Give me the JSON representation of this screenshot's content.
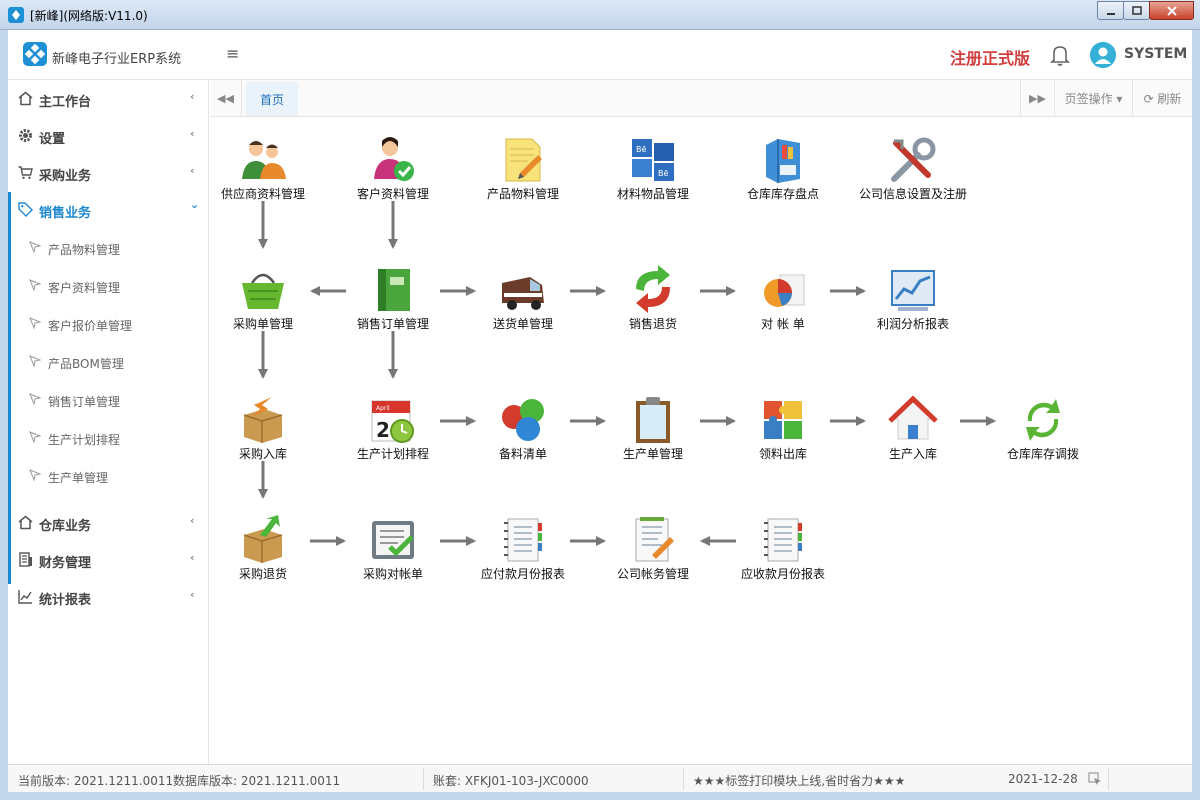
{
  "window": {
    "title": "[新峰](网络版:V11.0)"
  },
  "header": {
    "app_name": "新峰电子行业ERP系统",
    "menu_toggle": "≡",
    "register_label": "注册正式版",
    "user_name": "SYSTEM"
  },
  "sidebar": {
    "items": [
      {
        "label": "主工作台",
        "chev": "‹"
      },
      {
        "label": "设置",
        "chev": "‹"
      },
      {
        "label": "采购业务",
        "chev": "‹"
      },
      {
        "label": "销售业务",
        "chev": "⌄"
      },
      {
        "label": "仓库业务",
        "chev": "‹"
      },
      {
        "label": "财务管理",
        "chev": "‹"
      },
      {
        "label": "统计报表",
        "chev": "‹"
      }
    ],
    "sub_items": [
      {
        "label": "产品物料管理"
      },
      {
        "label": "客户资料管理"
      },
      {
        "label": "客户报价单管理"
      },
      {
        "label": "产品BOM管理"
      },
      {
        "label": "销售订单管理"
      },
      {
        "label": "生产计划排程"
      },
      {
        "label": "生产单管理"
      }
    ]
  },
  "tabs": {
    "nav_left": "◀◀",
    "home": "首页",
    "nav_right": "▶▶",
    "ops": "页签操作 ▾",
    "refresh": "⟳ 刷新"
  },
  "modules": [
    {
      "label": "供应商资料管理",
      "icon": "supplier-icon",
      "color": "#e8892c"
    },
    {
      "label": "客户资料管理",
      "icon": "customer-icon",
      "color": "#3ab54a"
    },
    {
      "label": "产品物料管理",
      "icon": "note-icon",
      "color": "#f3d34a"
    },
    {
      "label": "材料物品管理",
      "icon": "boxes-icon",
      "color": "#2f6fc2"
    },
    {
      "label": "仓库库存盘点",
      "icon": "archive-icon",
      "color": "#3f8fd6"
    },
    {
      "label": "公司信息设置及注册",
      "icon": "tools-icon",
      "color": "#7a8a99"
    },
    {
      "label": "采购单管理",
      "icon": "basket-icon",
      "color": "#66b82e"
    },
    {
      "label": "销售订单管理",
      "icon": "book-icon",
      "color": "#4aa63c"
    },
    {
      "label": "送货单管理",
      "icon": "van-icon",
      "color": "#6b3c2a"
    },
    {
      "label": "销售退货",
      "icon": "return-icon",
      "color": "#d33b2c"
    },
    {
      "label": "对 帐 单",
      "icon": "piechart-icon",
      "color": "#f09a2a"
    },
    {
      "label": "利润分析报表",
      "icon": "linechart-icon",
      "color": "#3a7fc4"
    },
    {
      "label": "采购入库",
      "icon": "box-in-icon",
      "color": "#c99a4f"
    },
    {
      "label": "生产计划排程",
      "icon": "calendar-icon",
      "color": "#d8352b"
    },
    {
      "label": "备料清单",
      "icon": "spheres-icon",
      "color": "#2e86d4"
    },
    {
      "label": "生产单管理",
      "icon": "clipboard-icon",
      "color": "#6a8fb2"
    },
    {
      "label": "领料出库",
      "icon": "puzzle-icon",
      "color": "#e0542f"
    },
    {
      "label": "生产入库",
      "icon": "house-icon",
      "color": "#3a7fd0"
    },
    {
      "label": "仓库库存调拨",
      "icon": "recycle-icon",
      "color": "#5ab535"
    },
    {
      "label": "采购退货",
      "icon": "box-out-icon",
      "color": "#c99a4f"
    },
    {
      "label": "采购对帐单",
      "icon": "checklist-icon",
      "color": "#6f7a82"
    },
    {
      "label": "应付款月份报表",
      "icon": "notebook-icon",
      "color": "#8a9aa8"
    },
    {
      "label": "公司帐务管理",
      "icon": "document-icon",
      "color": "#6f8aa0"
    },
    {
      "label": "应收款月份报表",
      "icon": "notebook-icon",
      "color": "#8a9aa8"
    }
  ],
  "status": {
    "version": "当前版本: 2021.1211.0011",
    "db_version": "数据库版本: 2021.1211.0011",
    "account": "账套: XFKJ01-103-JXC0000",
    "notice": "★★★标签打印模块上线,省时省力★★★",
    "date": "2021-12-28"
  }
}
